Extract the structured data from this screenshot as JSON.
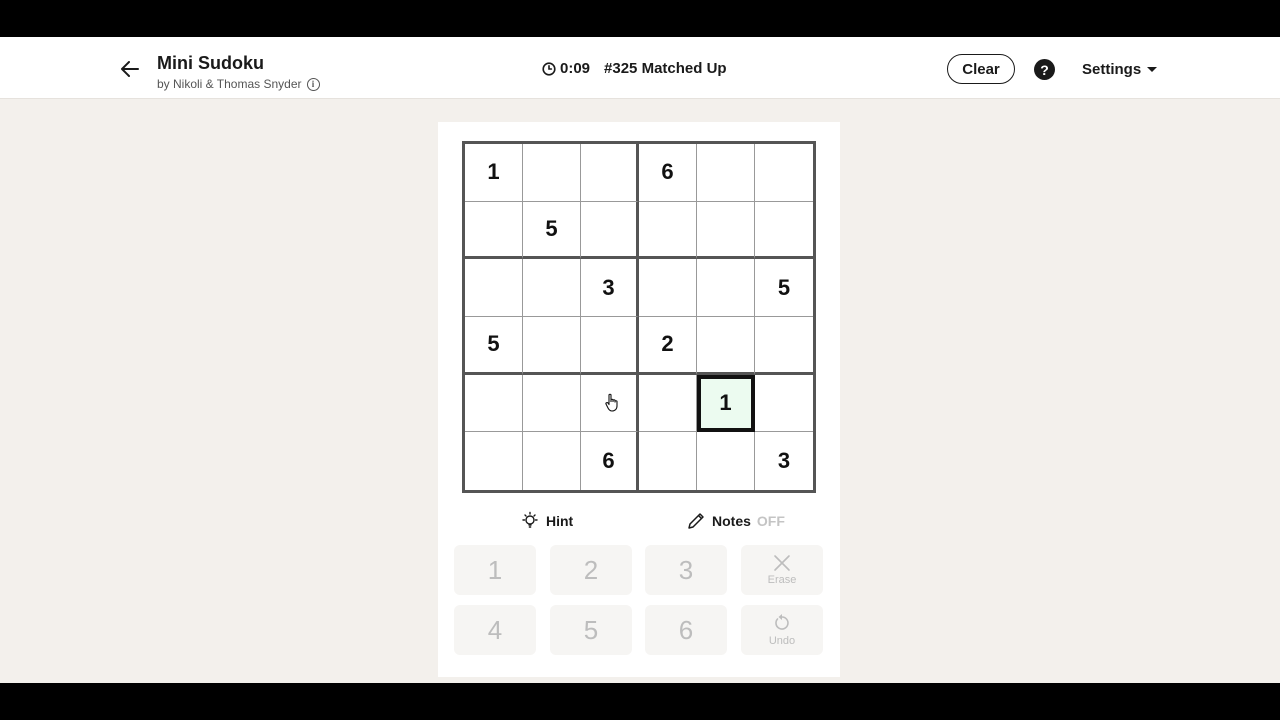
{
  "header": {
    "title": "Mini Sudoku",
    "byline": "by Nikoli & Thomas Snyder",
    "timer": "0:09",
    "puzzle": "#325 Matched Up",
    "clear_label": "Clear",
    "help_label": "?",
    "settings_label": "Settings"
  },
  "board": {
    "rows": [
      [
        "1",
        "",
        "",
        "6",
        "",
        ""
      ],
      [
        "",
        "5",
        "",
        "",
        "",
        ""
      ],
      [
        "",
        "",
        "3",
        "",
        "",
        "5"
      ],
      [
        "5",
        "",
        "",
        "2",
        "",
        ""
      ],
      [
        "",
        "",
        "",
        "",
        "1",
        ""
      ],
      [
        "",
        "",
        "6",
        "",
        "",
        "3"
      ]
    ],
    "selected": [
      4,
      4
    ]
  },
  "tools": {
    "hint_label": "Hint",
    "notes_label": "Notes",
    "notes_state": "OFF"
  },
  "keypad": {
    "digits": [
      "1",
      "2",
      "3",
      "4",
      "5",
      "6"
    ],
    "erase_label": "Erase",
    "undo_label": "Undo"
  }
}
